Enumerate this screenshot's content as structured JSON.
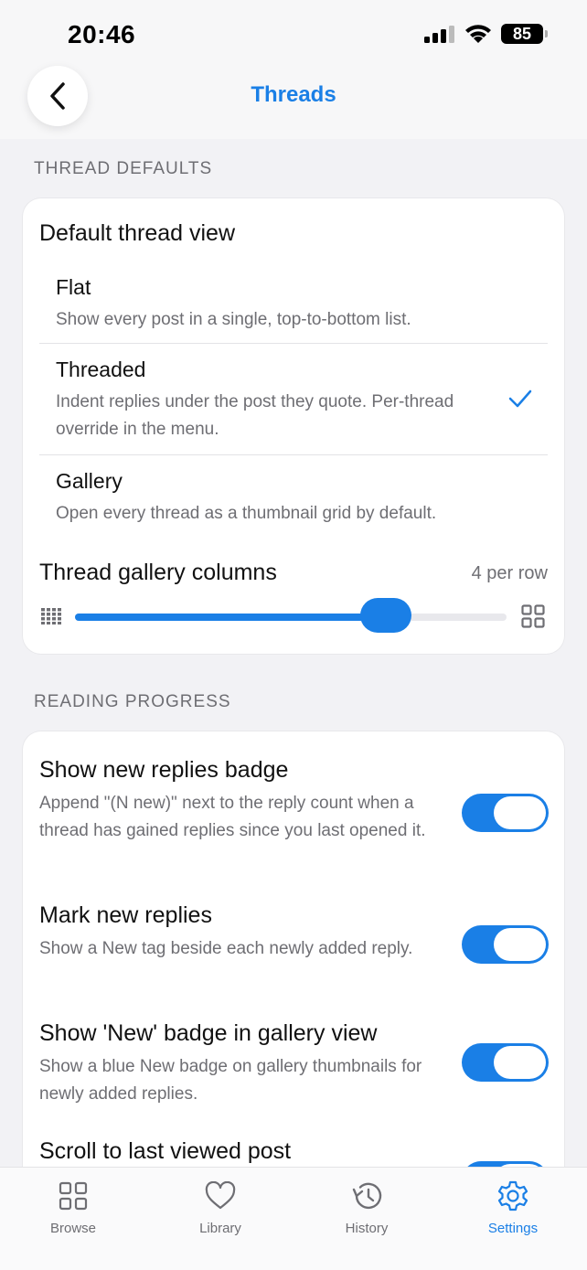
{
  "status": {
    "time": "20:46",
    "battery": "85"
  },
  "nav": {
    "title": "Threads"
  },
  "thread_defaults": {
    "header": "THREAD DEFAULTS",
    "view_title": "Default thread view",
    "options": [
      {
        "label": "Flat",
        "desc": "Show every post in a single, top-to-bottom list.",
        "selected": false
      },
      {
        "label": "Threaded",
        "desc": "Indent replies under the post they quote. Per-thread override in the menu.",
        "selected": true
      },
      {
        "label": "Gallery",
        "desc": "Open every thread as a thumbnail grid by default.",
        "selected": false
      }
    ],
    "columns_label": "Thread gallery columns",
    "columns_value": "4 per row",
    "slider_fraction": 0.72
  },
  "reading_progress": {
    "header": "READING PROGRESS",
    "items": [
      {
        "title": "Show new replies badge",
        "desc": "Append \"(N new)\" next to the reply count when a thread has gained replies since you last opened it.",
        "on": true
      },
      {
        "title": "Mark new replies",
        "desc": "Show a New tag beside each newly added reply.",
        "on": true
      },
      {
        "title": "Show 'New' badge in gallery view",
        "desc": "Show a blue New badge on gallery thumbnails for newly added replies.",
        "on": true
      },
      {
        "title": "Scroll to last viewed post",
        "desc": "",
        "on": true
      }
    ]
  },
  "tabs": [
    {
      "label": "Browse",
      "icon": "grid-icon",
      "active": false
    },
    {
      "label": "Library",
      "icon": "heart-icon",
      "active": false
    },
    {
      "label": "History",
      "icon": "history-icon",
      "active": false
    },
    {
      "label": "Settings",
      "icon": "gear-icon",
      "active": true
    }
  ],
  "colors": {
    "accent": "#1a7fe6",
    "background": "#f2f2f5"
  }
}
